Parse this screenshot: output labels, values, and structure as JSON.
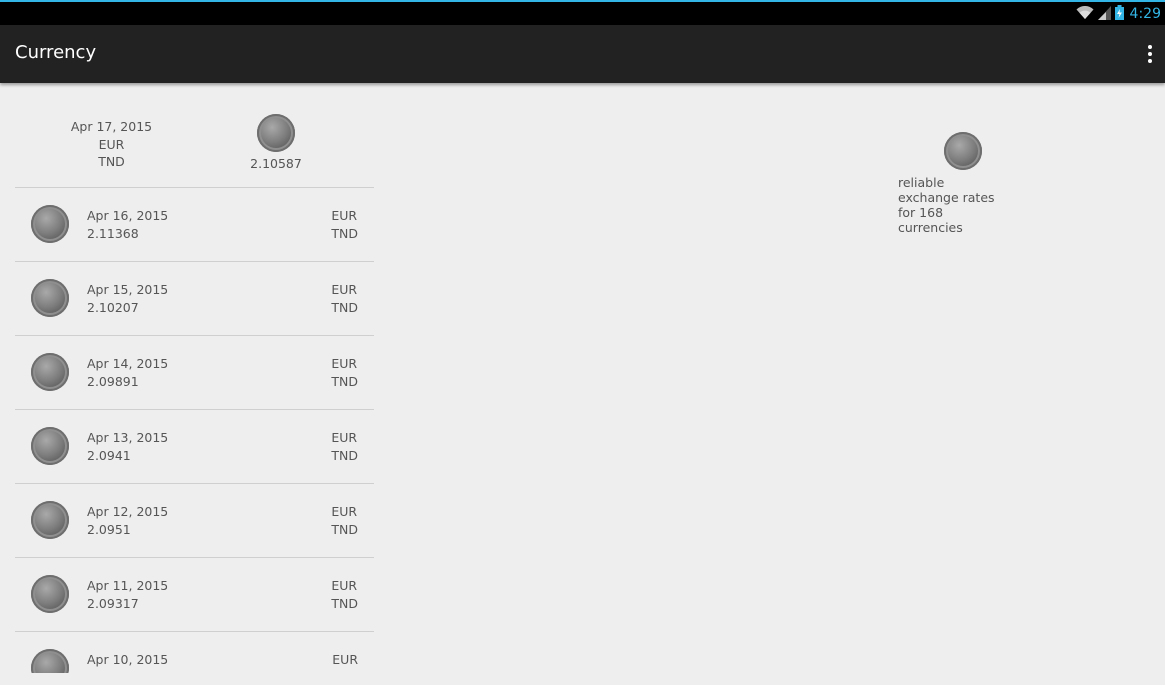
{
  "status_bar": {
    "time": "4:29",
    "icons": [
      "wifi-icon",
      "signal-icon",
      "battery-charging-icon"
    ]
  },
  "action_bar": {
    "title": "Currency",
    "overflow_icon": "more-vertical-icon"
  },
  "header": {
    "date": "Apr 17, 2015",
    "base": "EUR",
    "target": "TND",
    "value": "2.10587",
    "icon": "coin-icon"
  },
  "rates": [
    {
      "date": "Apr 16, 2015",
      "value": "2.11368",
      "base": "EUR",
      "target": "TND"
    },
    {
      "date": "Apr 15, 2015",
      "value": "2.10207",
      "base": "EUR",
      "target": "TND"
    },
    {
      "date": "Apr 14, 2015",
      "value": "2.09891",
      "base": "EUR",
      "target": "TND"
    },
    {
      "date": "Apr 13, 2015",
      "value": "2.0941",
      "base": "EUR",
      "target": "TND"
    },
    {
      "date": "Apr 12, 2015",
      "value": "2.0951",
      "base": "EUR",
      "target": "TND"
    },
    {
      "date": "Apr 11, 2015",
      "value": "2.09317",
      "base": "EUR",
      "target": "TND"
    },
    {
      "date": "Apr 10, 2015",
      "value": "",
      "base": "EUR",
      "target": ""
    }
  ],
  "promo": {
    "text": "reliable exchange rates for 168 currencies",
    "icon": "coin-icon"
  },
  "colors": {
    "accent": "#33b5e5",
    "action_bar": "#222222",
    "background": "#eeeeee",
    "text": "#555555"
  }
}
